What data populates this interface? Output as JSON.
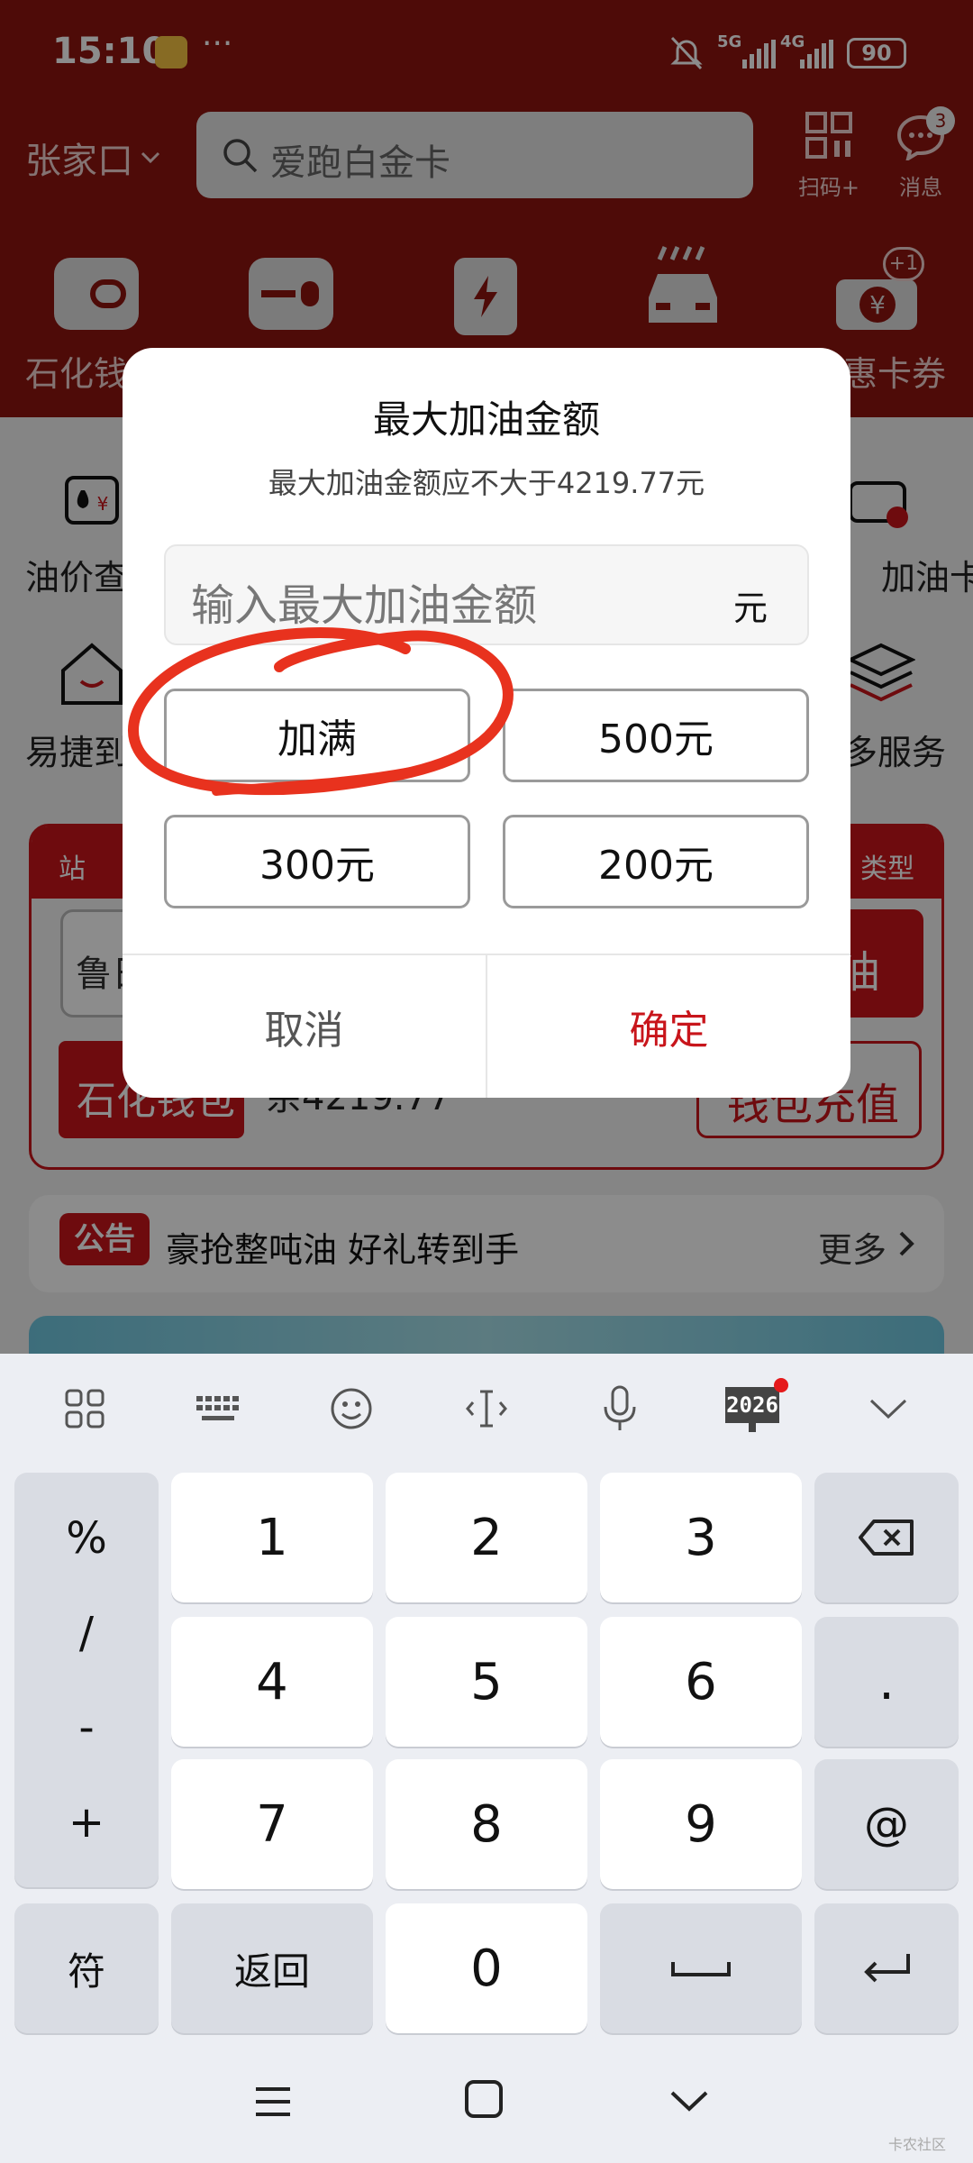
{
  "status_bar": {
    "time": "15:10",
    "more": "···",
    "sig1": "5G",
    "sig2": "4G",
    "battery": "90"
  },
  "header": {
    "city": "张家口",
    "search_placeholder": "爱跑白金卡",
    "scan_label": "扫码+",
    "messages_label": "消息",
    "messages_badge": "3",
    "coupon_badge": "+1"
  },
  "nav": {
    "item1_partial": "石化钱",
    "item5_partial": "惠卡券"
  },
  "page": {
    "left_label1": "油价查",
    "right_label1": "加油卡",
    "left_label2": "易捷到",
    "right_label2": "多服务",
    "station_partial": "站",
    "type_partial": "类型",
    "input_partial": "鲁日",
    "refuel_partial": "油",
    "wallet_partial": "石化钱包",
    "balance_partial": "余4219.77",
    "recharge_partial": "钱包充值",
    "notice_tag": "公告",
    "notice_text": "豪抢整吨油 好礼转到手",
    "notice_more": "更多"
  },
  "dialog": {
    "title": "最大加油金额",
    "subtitle": "最大加油金额应不大于4219.77元",
    "input_placeholder": "输入最大加油金额",
    "unit": "元",
    "presets": [
      "加满",
      "500元",
      "300元",
      "200元"
    ],
    "cancel": "取消",
    "confirm": "确定",
    "confirm_color": "#c8151b"
  },
  "keyboard": {
    "toolbar": [
      "apps-grid-icon",
      "keyboard-icon",
      "emoji-icon",
      "cursor-icon",
      "mic-icon",
      "calendar-2026-icon",
      "collapse-icon"
    ],
    "toolbar_badge_text": "2026",
    "symbols": [
      "%",
      "/",
      "-",
      "+"
    ],
    "digits": [
      "1",
      "2",
      "3",
      "4",
      "5",
      "6",
      "7",
      "8",
      "9",
      "0"
    ],
    "dot": ".",
    "at": "@",
    "fu": "符",
    "back": "返回"
  },
  "watermark": "卡农社区"
}
